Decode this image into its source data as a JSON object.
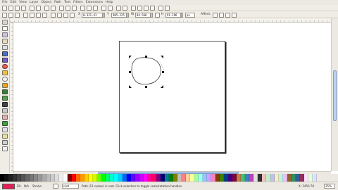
{
  "menubar": {
    "items": [
      "File",
      "Edit",
      "View",
      "Layer",
      "Object",
      "Path",
      "Text",
      "Filters",
      "Extensions",
      "Help"
    ]
  },
  "controls": {
    "x_label": "X",
    "x_value": "0.321.41",
    "y_label": "Y",
    "y_value": "905.225",
    "w_label": "W",
    "w_value": "84.566",
    "h_label": "H",
    "h_value": "91.196",
    "unit": "px",
    "affect_label": "Affect:"
  },
  "colors": {
    "accent_fill": "#e8205a",
    "page_border": "#555555",
    "scroll_thumb": "#b9d2f0"
  },
  "palette": [
    "#000000",
    "#111111",
    "#222222",
    "#333333",
    "#444444",
    "#555555",
    "#666666",
    "#777777",
    "#888888",
    "#999999",
    "#aaaaaa",
    "#bbbbbb",
    "#cccccc",
    "#dddddd",
    "#eeeeee",
    "#ffffff",
    "#800000",
    "#ff0000",
    "#ff6a00",
    "#ff9900",
    "#ffcc00",
    "#ffff00",
    "#ccff00",
    "#66ff00",
    "#00ff00",
    "#00ff66",
    "#00ffcc",
    "#00ffff",
    "#00ccff",
    "#0066ff",
    "#0000ff",
    "#6600ff",
    "#9900ff",
    "#cc00ff",
    "#ff00ff",
    "#ff0099",
    "#ff0066",
    "#800080",
    "#000080",
    "#008080",
    "#008000",
    "#808000",
    "#c0c0c0",
    "#ff8080",
    "#ffd0a0",
    "#ffffa0",
    "#a0ffa0",
    "#a0ffff",
    "#a0c0ff",
    "#d0a0ff",
    "#ff80c0",
    "#804000",
    "#408000",
    "#004080",
    "#400080",
    "#800040",
    "#c08040",
    "#40c080",
    "#4080c0",
    "#c040c0",
    "#e0e0e0",
    "#303030",
    "#f0c0c0",
    "#c0f0c0",
    "#c0c0f0",
    "#f0f0c0",
    "#c0f0f0",
    "#f0c0f0",
    "#906030",
    "#309060",
    "#306090",
    "#903060",
    "#ffe0ff",
    "#e0ffe0",
    "#e0e0ff"
  ],
  "status": {
    "fill_label": "Fill:",
    "stroke_label": "Stroke:",
    "fill_value": "N/A",
    "layer": "root",
    "message": "Path (11 nodes) in root. Click selection to toggle scale/rotation handles.",
    "coords": "X: 2450.78",
    "zoom": "35%"
  }
}
